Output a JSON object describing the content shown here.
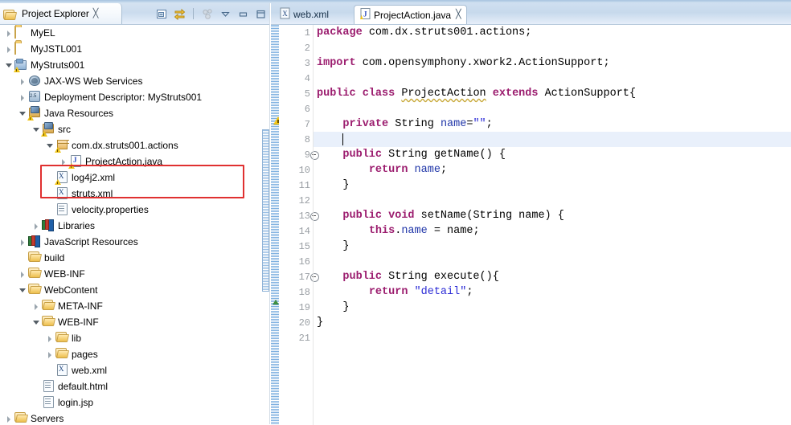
{
  "explorer": {
    "tab_title": "Project Explorer",
    "close_glyph": "╳",
    "toolbar": [
      {
        "name": "collapse-all-icon",
        "glyph": "⊟"
      },
      {
        "name": "link-with-editor-icon",
        "glyph": "⇄"
      },
      {
        "name": "focus-on-active-task-icon",
        "glyph": "⚇"
      },
      {
        "name": "view-menu-icon",
        "glyph": "▽"
      },
      {
        "name": "minimize-icon",
        "glyph": "−"
      },
      {
        "name": "maximize-icon",
        "glyph": "□"
      }
    ],
    "tree": [
      {
        "label": "MyEL",
        "indent": 0,
        "arrow": "collapsed",
        "icon": "folder",
        "warn": false
      },
      {
        "label": "MyJSTL001",
        "indent": 0,
        "arrow": "collapsed",
        "icon": "folder",
        "warn": false
      },
      {
        "label": "MyStruts001",
        "indent": 0,
        "arrow": "expanded",
        "icon": "project",
        "warn": true
      },
      {
        "label": "JAX-WS Web Services",
        "indent": 1,
        "arrow": "collapsed",
        "icon": "jaxws",
        "warn": false
      },
      {
        "label": "Deployment Descriptor: MyStruts001",
        "indent": 1,
        "arrow": "collapsed",
        "icon": "dd",
        "warn": false
      },
      {
        "label": "Java Resources",
        "indent": 1,
        "arrow": "expanded",
        "icon": "javares",
        "warn": true
      },
      {
        "label": "src",
        "indent": 2,
        "arrow": "expanded",
        "icon": "javares",
        "warn": true
      },
      {
        "label": "com.dx.struts001.actions",
        "indent": 3,
        "arrow": "expanded",
        "icon": "package",
        "warn": true
      },
      {
        "label": "ProjectAction.java",
        "indent": 4,
        "arrow": "collapsed",
        "icon": "java",
        "warn": true
      },
      {
        "label": "log4j2.xml",
        "indent": 3,
        "arrow": "none",
        "icon": "xml",
        "warn": true
      },
      {
        "label": "struts.xml",
        "indent": 3,
        "arrow": "none",
        "icon": "xml",
        "warn": false
      },
      {
        "label": "velocity.properties",
        "indent": 3,
        "arrow": "none",
        "icon": "doc",
        "warn": false
      },
      {
        "label": "Libraries",
        "indent": 2,
        "arrow": "collapsed",
        "icon": "library",
        "warn": false
      },
      {
        "label": "JavaScript Resources",
        "indent": 1,
        "arrow": "collapsed",
        "icon": "library",
        "warn": false
      },
      {
        "label": "build",
        "indent": 1,
        "arrow": "none",
        "icon": "folder-open",
        "warn": false
      },
      {
        "label": "WEB-INF",
        "indent": 1,
        "arrow": "collapsed",
        "icon": "folder-open",
        "warn": false
      },
      {
        "label": "WebContent",
        "indent": 1,
        "arrow": "expanded",
        "icon": "folder-open",
        "warn": false
      },
      {
        "label": "META-INF",
        "indent": 2,
        "arrow": "collapsed",
        "icon": "folder-open",
        "warn": false
      },
      {
        "label": "WEB-INF",
        "indent": 2,
        "arrow": "expanded",
        "icon": "folder-open",
        "warn": false
      },
      {
        "label": "lib",
        "indent": 3,
        "arrow": "collapsed",
        "icon": "folder-open",
        "warn": false
      },
      {
        "label": "pages",
        "indent": 3,
        "arrow": "collapsed",
        "icon": "folder-open",
        "warn": false
      },
      {
        "label": "web.xml",
        "indent": 3,
        "arrow": "none",
        "icon": "xml",
        "warn": false
      },
      {
        "label": "default.html",
        "indent": 2,
        "arrow": "none",
        "icon": "doc",
        "warn": false
      },
      {
        "label": "login.jsp",
        "indent": 2,
        "arrow": "none",
        "icon": "doc",
        "warn": false
      },
      {
        "label": "Servers",
        "indent": 0,
        "arrow": "collapsed",
        "icon": "folder-open",
        "warn": false
      }
    ],
    "highlight_color": "#e03030"
  },
  "editor": {
    "tabs": [
      {
        "label": "web.xml",
        "icon": "xml-file-icon",
        "active": false
      },
      {
        "label": "ProjectAction.java",
        "icon": "java-file-icon",
        "active": true
      }
    ],
    "close_glyph": "╳",
    "current_line": 8,
    "lines": [
      {
        "n": "1",
        "fold": false,
        "tokens": [
          {
            "t": "package",
            "c": "kw"
          },
          {
            "t": " com.dx.struts001.actions;",
            "c": "plain"
          }
        ]
      },
      {
        "n": "2",
        "fold": false,
        "tokens": []
      },
      {
        "n": "3",
        "fold": false,
        "tokens": [
          {
            "t": "import",
            "c": "kw"
          },
          {
            "t": " com.opensymphony.xwork2.ActionSupport;",
            "c": "plain"
          }
        ]
      },
      {
        "n": "4",
        "fold": false,
        "tokens": []
      },
      {
        "n": "5",
        "fold": false,
        "tokens": [
          {
            "t": "public class",
            "c": "kw"
          },
          {
            "t": " ",
            "c": "plain"
          },
          {
            "t": "ProjectAction",
            "c": "warn"
          },
          {
            "t": " ",
            "c": "plain"
          },
          {
            "t": "extends",
            "c": "kw"
          },
          {
            "t": " ActionSupport{",
            "c": "plain"
          }
        ]
      },
      {
        "n": "6",
        "fold": false,
        "tokens": []
      },
      {
        "n": "7",
        "fold": false,
        "tokens": [
          {
            "t": "    ",
            "c": "plain"
          },
          {
            "t": "private",
            "c": "kw"
          },
          {
            "t": " String ",
            "c": "plain"
          },
          {
            "t": "name",
            "c": "fld"
          },
          {
            "t": "=",
            "c": "plain"
          },
          {
            "t": "\"\"",
            "c": "str"
          },
          {
            "t": ";",
            "c": "plain"
          }
        ]
      },
      {
        "n": "8",
        "fold": false,
        "tokens": []
      },
      {
        "n": "9",
        "fold": true,
        "tokens": [
          {
            "t": "    ",
            "c": "plain"
          },
          {
            "t": "public",
            "c": "kw"
          },
          {
            "t": " String getName() {",
            "c": "plain"
          }
        ]
      },
      {
        "n": "10",
        "fold": false,
        "tokens": [
          {
            "t": "        ",
            "c": "plain"
          },
          {
            "t": "return",
            "c": "kw"
          },
          {
            "t": " ",
            "c": "plain"
          },
          {
            "t": "name",
            "c": "fld"
          },
          {
            "t": ";",
            "c": "plain"
          }
        ]
      },
      {
        "n": "11",
        "fold": false,
        "tokens": [
          {
            "t": "    }",
            "c": "plain"
          }
        ]
      },
      {
        "n": "12",
        "fold": false,
        "tokens": []
      },
      {
        "n": "13",
        "fold": true,
        "tokens": [
          {
            "t": "    ",
            "c": "plain"
          },
          {
            "t": "public void",
            "c": "kw"
          },
          {
            "t": " setName(String name) {",
            "c": "plain"
          }
        ]
      },
      {
        "n": "14",
        "fold": false,
        "tokens": [
          {
            "t": "        ",
            "c": "plain"
          },
          {
            "t": "this",
            "c": "kw"
          },
          {
            "t": ".",
            "c": "plain"
          },
          {
            "t": "name",
            "c": "fld"
          },
          {
            "t": " = name;",
            "c": "plain"
          }
        ]
      },
      {
        "n": "15",
        "fold": false,
        "tokens": [
          {
            "t": "    }",
            "c": "plain"
          }
        ]
      },
      {
        "n": "16",
        "fold": false,
        "tokens": []
      },
      {
        "n": "17",
        "fold": true,
        "tokens": [
          {
            "t": "    ",
            "c": "plain"
          },
          {
            "t": "public",
            "c": "kw"
          },
          {
            "t": " String execute(){",
            "c": "plain"
          }
        ]
      },
      {
        "n": "18",
        "fold": false,
        "tokens": [
          {
            "t": "        ",
            "c": "plain"
          },
          {
            "t": "return",
            "c": "kw"
          },
          {
            "t": " ",
            "c": "plain"
          },
          {
            "t": "\"detail\"",
            "c": "str"
          },
          {
            "t": ";",
            "c": "plain"
          }
        ]
      },
      {
        "n": "19",
        "fold": false,
        "tokens": [
          {
            "t": "    }",
            "c": "plain"
          }
        ]
      },
      {
        "n": "20",
        "fold": false,
        "tokens": [
          {
            "t": "}",
            "c": "plain"
          }
        ]
      },
      {
        "n": "21",
        "fold": false,
        "tokens": []
      }
    ],
    "colors": {
      "keyword": "#9b1c6e",
      "string": "#2a2ad6",
      "field": "#1f35a8",
      "current_line_bg": "#e9f0fb",
      "warning_underline": "#c8a93a"
    }
  }
}
